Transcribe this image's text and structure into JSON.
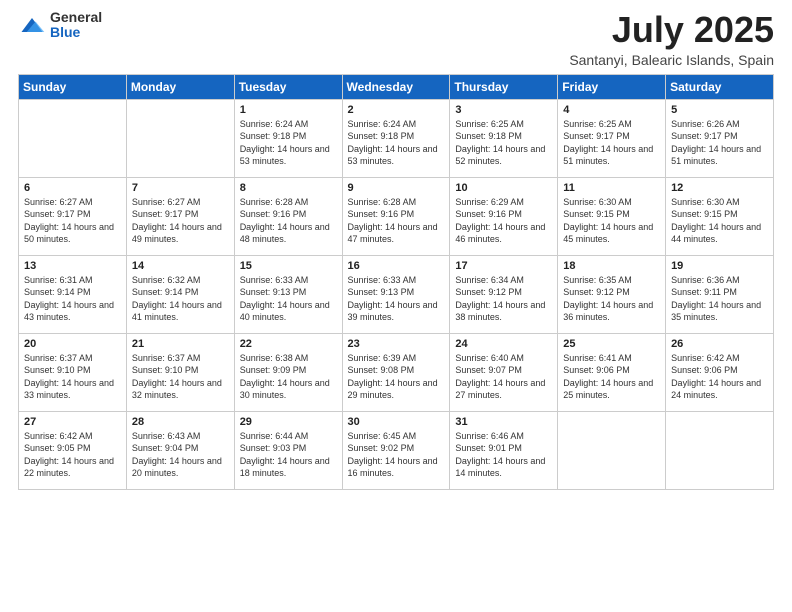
{
  "header": {
    "logo_general": "General",
    "logo_blue": "Blue",
    "month_title": "July 2025",
    "location": "Santanyi, Balearic Islands, Spain"
  },
  "days_of_week": [
    "Sunday",
    "Monday",
    "Tuesday",
    "Wednesday",
    "Thursday",
    "Friday",
    "Saturday"
  ],
  "weeks": [
    [
      {
        "num": "",
        "info": ""
      },
      {
        "num": "",
        "info": ""
      },
      {
        "num": "1",
        "info": "Sunrise: 6:24 AM\nSunset: 9:18 PM\nDaylight: 14 hours and 53 minutes."
      },
      {
        "num": "2",
        "info": "Sunrise: 6:24 AM\nSunset: 9:18 PM\nDaylight: 14 hours and 53 minutes."
      },
      {
        "num": "3",
        "info": "Sunrise: 6:25 AM\nSunset: 9:18 PM\nDaylight: 14 hours and 52 minutes."
      },
      {
        "num": "4",
        "info": "Sunrise: 6:25 AM\nSunset: 9:17 PM\nDaylight: 14 hours and 51 minutes."
      },
      {
        "num": "5",
        "info": "Sunrise: 6:26 AM\nSunset: 9:17 PM\nDaylight: 14 hours and 51 minutes."
      }
    ],
    [
      {
        "num": "6",
        "info": "Sunrise: 6:27 AM\nSunset: 9:17 PM\nDaylight: 14 hours and 50 minutes."
      },
      {
        "num": "7",
        "info": "Sunrise: 6:27 AM\nSunset: 9:17 PM\nDaylight: 14 hours and 49 minutes."
      },
      {
        "num": "8",
        "info": "Sunrise: 6:28 AM\nSunset: 9:16 PM\nDaylight: 14 hours and 48 minutes."
      },
      {
        "num": "9",
        "info": "Sunrise: 6:28 AM\nSunset: 9:16 PM\nDaylight: 14 hours and 47 minutes."
      },
      {
        "num": "10",
        "info": "Sunrise: 6:29 AM\nSunset: 9:16 PM\nDaylight: 14 hours and 46 minutes."
      },
      {
        "num": "11",
        "info": "Sunrise: 6:30 AM\nSunset: 9:15 PM\nDaylight: 14 hours and 45 minutes."
      },
      {
        "num": "12",
        "info": "Sunrise: 6:30 AM\nSunset: 9:15 PM\nDaylight: 14 hours and 44 minutes."
      }
    ],
    [
      {
        "num": "13",
        "info": "Sunrise: 6:31 AM\nSunset: 9:14 PM\nDaylight: 14 hours and 43 minutes."
      },
      {
        "num": "14",
        "info": "Sunrise: 6:32 AM\nSunset: 9:14 PM\nDaylight: 14 hours and 41 minutes."
      },
      {
        "num": "15",
        "info": "Sunrise: 6:33 AM\nSunset: 9:13 PM\nDaylight: 14 hours and 40 minutes."
      },
      {
        "num": "16",
        "info": "Sunrise: 6:33 AM\nSunset: 9:13 PM\nDaylight: 14 hours and 39 minutes."
      },
      {
        "num": "17",
        "info": "Sunrise: 6:34 AM\nSunset: 9:12 PM\nDaylight: 14 hours and 38 minutes."
      },
      {
        "num": "18",
        "info": "Sunrise: 6:35 AM\nSunset: 9:12 PM\nDaylight: 14 hours and 36 minutes."
      },
      {
        "num": "19",
        "info": "Sunrise: 6:36 AM\nSunset: 9:11 PM\nDaylight: 14 hours and 35 minutes."
      }
    ],
    [
      {
        "num": "20",
        "info": "Sunrise: 6:37 AM\nSunset: 9:10 PM\nDaylight: 14 hours and 33 minutes."
      },
      {
        "num": "21",
        "info": "Sunrise: 6:37 AM\nSunset: 9:10 PM\nDaylight: 14 hours and 32 minutes."
      },
      {
        "num": "22",
        "info": "Sunrise: 6:38 AM\nSunset: 9:09 PM\nDaylight: 14 hours and 30 minutes."
      },
      {
        "num": "23",
        "info": "Sunrise: 6:39 AM\nSunset: 9:08 PM\nDaylight: 14 hours and 29 minutes."
      },
      {
        "num": "24",
        "info": "Sunrise: 6:40 AM\nSunset: 9:07 PM\nDaylight: 14 hours and 27 minutes."
      },
      {
        "num": "25",
        "info": "Sunrise: 6:41 AM\nSunset: 9:06 PM\nDaylight: 14 hours and 25 minutes."
      },
      {
        "num": "26",
        "info": "Sunrise: 6:42 AM\nSunset: 9:06 PM\nDaylight: 14 hours and 24 minutes."
      }
    ],
    [
      {
        "num": "27",
        "info": "Sunrise: 6:42 AM\nSunset: 9:05 PM\nDaylight: 14 hours and 22 minutes."
      },
      {
        "num": "28",
        "info": "Sunrise: 6:43 AM\nSunset: 9:04 PM\nDaylight: 14 hours and 20 minutes."
      },
      {
        "num": "29",
        "info": "Sunrise: 6:44 AM\nSunset: 9:03 PM\nDaylight: 14 hours and 18 minutes."
      },
      {
        "num": "30",
        "info": "Sunrise: 6:45 AM\nSunset: 9:02 PM\nDaylight: 14 hours and 16 minutes."
      },
      {
        "num": "31",
        "info": "Sunrise: 6:46 AM\nSunset: 9:01 PM\nDaylight: 14 hours and 14 minutes."
      },
      {
        "num": "",
        "info": ""
      },
      {
        "num": "",
        "info": ""
      }
    ]
  ]
}
